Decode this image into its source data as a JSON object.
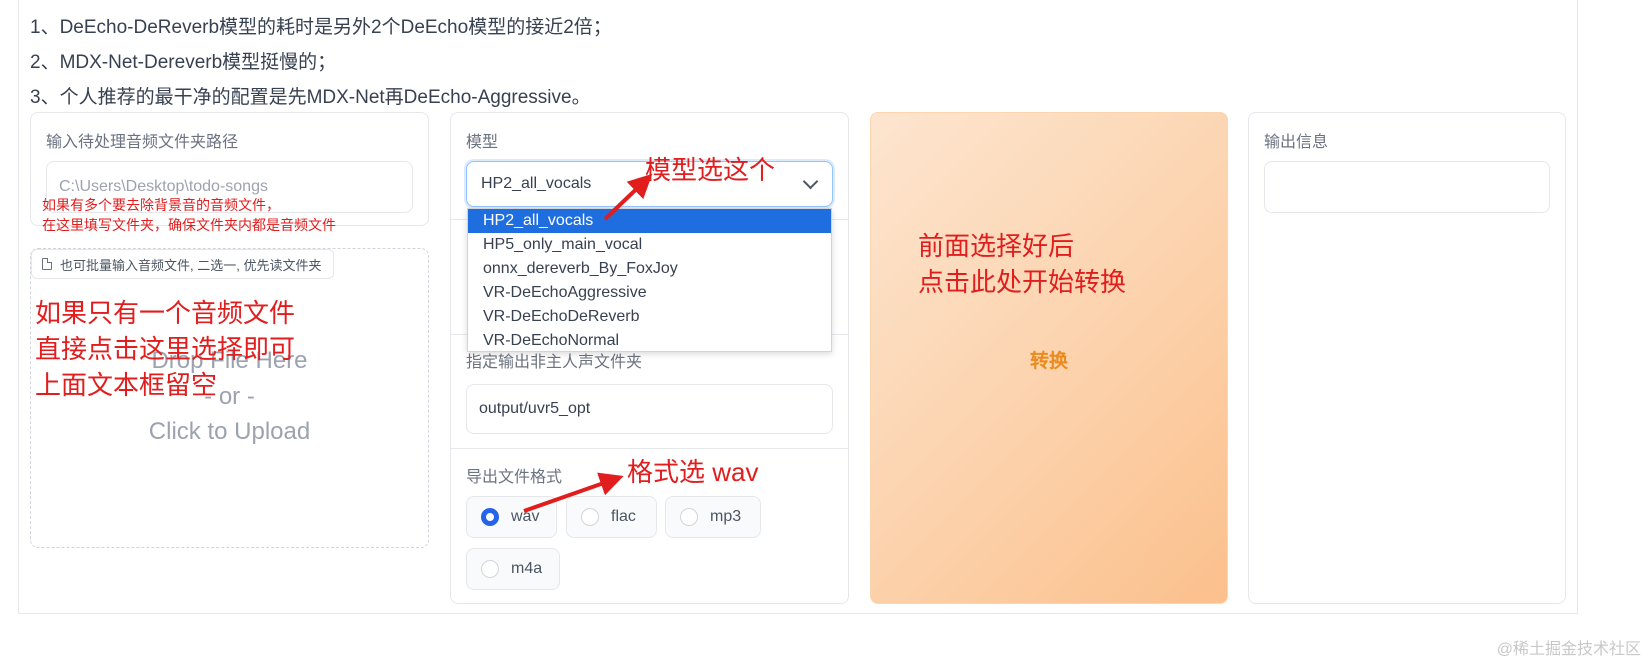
{
  "notes": [
    "1、DeEcho-DeReverb模型的耗时是另外2个DeEcho模型的接近2倍；",
    "2、MDX-Net-Dereverb模型挺慢的；",
    "3、个人推荐的最干净的配置是先MDX-Net再DeEcho-Aggressive。"
  ],
  "input_panel": {
    "label": "输入待处理音频文件夹路径",
    "placeholder": "C:\\Users\\Desktop\\todo-songs"
  },
  "upload": {
    "chip_label": "也可批量输入音频文件, 二选一, 优先读文件夹",
    "drop_line1": "Drop File Here",
    "drop_line2": "- or -",
    "drop_line3": "Click to Upload"
  },
  "model_panel": {
    "label": "模型",
    "selected": "HP2_all_vocals",
    "options": [
      "HP2_all_vocals",
      "HP5_only_main_vocal",
      "onnx_dereverb_By_FoxJoy",
      "VR-DeEchoAggressive",
      "VR-DeEchoDeReverb",
      "VR-DeEchoNormal"
    ]
  },
  "output_dir": {
    "label": "指定输出非主人声文件夹",
    "value": "output/uvr5_opt"
  },
  "format": {
    "label": "导出文件格式",
    "options": [
      "wav",
      "flac",
      "mp3",
      "m4a"
    ],
    "selected": "wav"
  },
  "convert_button": {
    "label": "转换"
  },
  "output_panel": {
    "label": "输出信息",
    "value": ""
  },
  "annotations": {
    "folder_line1": "如果有多个要去除背景音的音频文件，",
    "folder_line2": "在这里填写文件夹，确保文件夹内都是音频文件",
    "single_line1": "如果只有一个音频文件",
    "single_line2": "直接点击这里选择即可",
    "single_line3": "上面文本框留空",
    "model_pick": "模型选这个",
    "format_pick": "格式选 wav",
    "convert_line1": "前面选择好后",
    "convert_line2": "点击此处开始转换"
  },
  "watermark": "@稀土掘金技术社区",
  "colors": {
    "annotation": "#e11d1d",
    "accent": "#2563eb",
    "convert_text": "#ea8a1d"
  }
}
